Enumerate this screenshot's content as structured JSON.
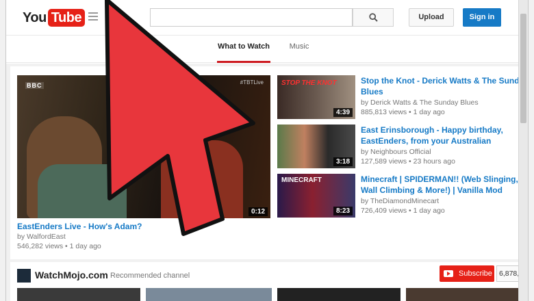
{
  "logo": {
    "you": "You",
    "tube": "Tube"
  },
  "header": {
    "upload_label": "Upload",
    "signin_label": "Sign in"
  },
  "tabs": [
    {
      "label": "What to Watch",
      "active": true
    },
    {
      "label": "Music",
      "active": false
    }
  ],
  "featured": {
    "title": "EastEnders Live - How's Adam?",
    "channel": "by WalfordEast",
    "stats": "546,282 views • 1 day ago",
    "duration": "0:12",
    "channel_badge": "BBC",
    "hashtag": "#TBTLive"
  },
  "videos": [
    {
      "title_line1": "Stop the Knot - Derick Watts & The Sunday",
      "title_line2": "Blues",
      "channel": "by Derick Watts & The Sunday Blues",
      "stats": "885,813 views • 1 day ago",
      "duration": "4:39",
      "thumb_text": "STOP THE KNOT"
    },
    {
      "title_line1": "East Erinsborough - Happy birthday,",
      "title_line2": "EastEnders, from your Australian",
      "channel": "by Neighbours Official",
      "stats": "127,589 views • 23 hours ago",
      "duration": "3:18",
      "thumb_text": ""
    },
    {
      "title_line1": "Minecraft | SPIDERMAN!! (Web Slinging,",
      "title_line2": "Wall Climbing & More!) | Vanilla Mod",
      "channel": "by TheDiamondMinecart",
      "stats": "726,409 views • 1 day ago",
      "duration": "8:23",
      "thumb_text": "MINECRAFT"
    }
  ],
  "shelf": {
    "channel_name": "WatchMojo.com",
    "subtitle": "Recommended channel",
    "subscribe_label": "Subscribe",
    "subscriber_count": "6,878,"
  },
  "colors": {
    "brand_red": "#e62117",
    "link_blue": "#167ac6",
    "arrow_red": "#e8363c"
  }
}
